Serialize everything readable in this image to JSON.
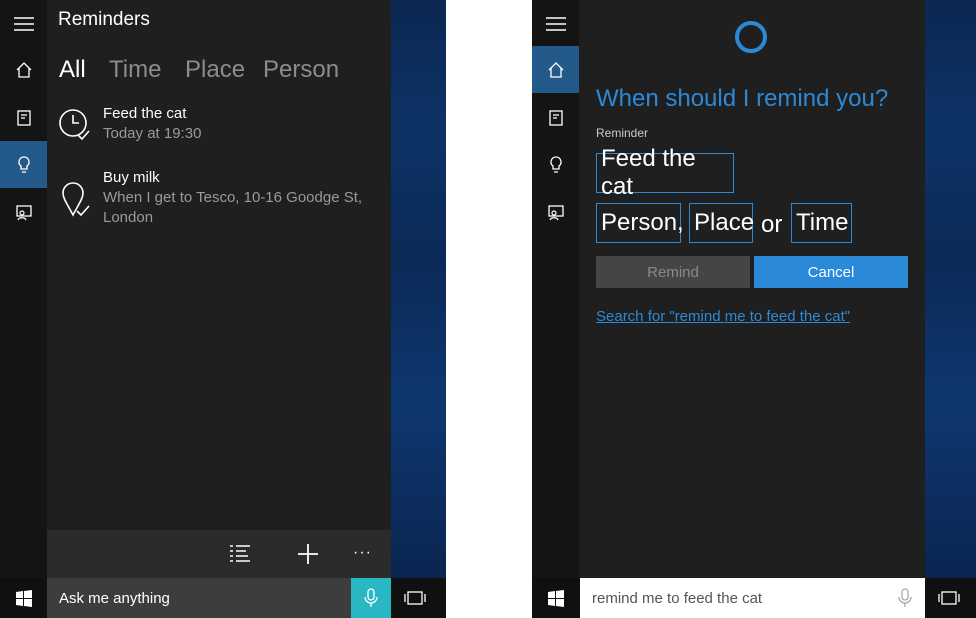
{
  "left": {
    "title": "Reminders",
    "filters": [
      "All",
      "Time",
      "Place",
      "Person"
    ],
    "reminders": [
      {
        "title": "Feed the cat",
        "detail": "Today at 19:30"
      },
      {
        "title": "Buy milk",
        "detail": "When I get to Tesco, 10-16 Goodge St, London"
      }
    ],
    "bottom_more": "···",
    "search_placeholder": "Ask me anything"
  },
  "right": {
    "question": "When should I remind you?",
    "reminder_label": "Reminder",
    "reminder_text": "Feed the cat",
    "person_label": "Person,",
    "place_label": "Place",
    "or_label": "or",
    "time_label": "Time",
    "remind_button": "Remind",
    "cancel_button": "Cancel",
    "search_link": "Search for \"remind me to feed the cat\"",
    "search_value": "remind me to feed the cat"
  },
  "colors": {
    "accent": "#2b8ad8",
    "mic_active": "#2ab7c4",
    "panel": "#1f1f1f",
    "rail": "#141414"
  }
}
